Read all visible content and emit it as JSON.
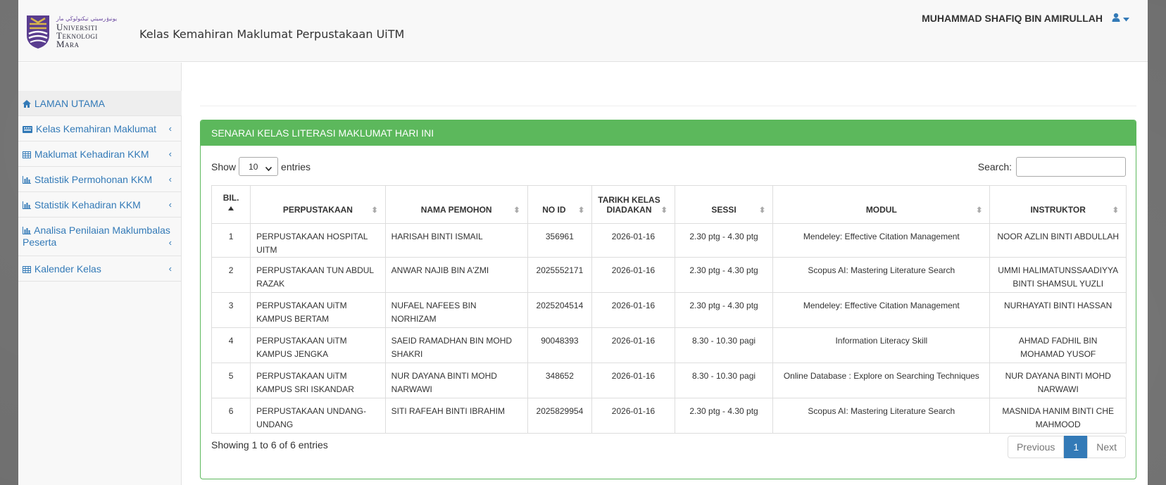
{
  "header": {
    "logo_jawi": "ﻳﻮﻧﻴۏرسيتي تيکنولوڬي مار",
    "logo_lines": [
      "Universiti",
      "Teknologi",
      "Mara"
    ],
    "app_title": "Kelas Kemahiran Maklumat Perpustakaan UiTM",
    "user_name": "MUHAMMAD SHAFIQ BIN AMIRULLAH"
  },
  "sidebar": {
    "items": [
      {
        "label": "LAMAN UTAMA",
        "icon": "home-icon"
      },
      {
        "label": "Kelas Kemahiran Maklumat",
        "icon": "keyboard-icon"
      },
      {
        "label": "Maklumat Kehadiran KKM",
        "icon": "table-icon"
      },
      {
        "label": "Statistik Permohonan KKM",
        "icon": "bar-chart-icon"
      },
      {
        "label": "Statistik Kehadiran KKM",
        "icon": "bar-chart-icon"
      },
      {
        "label": "Analisa Penilaian Maklumbalas",
        "label2": "Peserta",
        "icon": "bar-chart-icon"
      },
      {
        "label": "Kalender Kelas",
        "icon": "table-icon"
      }
    ]
  },
  "panel": {
    "heading": "SENARAI KELAS LITERASI MAKLUMAT HARI INI",
    "show_label": "Show",
    "entries_label": "entries",
    "page_length": "10",
    "search_label": "Search:",
    "search_value": "",
    "info": "Showing 1 to 6 of 6 entries",
    "pager": {
      "previous": "Previous",
      "current": "1",
      "next": "Next"
    }
  },
  "table": {
    "headers": [
      {
        "l1": "BIL.",
        "l2": ""
      },
      {
        "l1": "PERPUSTAKAAN",
        "l2": ""
      },
      {
        "l1": "NAMA PEMOHON",
        "l2": ""
      },
      {
        "l1": "NO ID",
        "l2": ""
      },
      {
        "l1": "TARIKH KELAS",
        "l2": "DIADAKAN"
      },
      {
        "l1": "SESSI",
        "l2": ""
      },
      {
        "l1": "MODUL",
        "l2": ""
      },
      {
        "l1": "INSTRUKTOR",
        "l2": ""
      }
    ],
    "rows": [
      [
        "1",
        "PERPUSTAKAAN HOSPITAL UITM",
        "HARISAH BINTI ISMAIL",
        "356961",
        "2026-01-16",
        "2.30 ptg - 4.30 ptg",
        "Mendeley: Effective Citation Management",
        "NOOR AZLIN BINTI ABDULLAH"
      ],
      [
        "2",
        "PERPUSTAKAAN TUN ABDUL RAZAK",
        "ANWAR NAJIB BIN A'ZMI",
        "2025552171",
        "2026-01-16",
        "2.30 ptg - 4.30 ptg",
        "Scopus AI: Mastering Literature Search",
        "UMMI HALIMATUNSSAADIYYA BINTI SHAMSUL YUZLI"
      ],
      [
        "3",
        "PERPUSTAKAAN UiTM KAMPUS BERTAM",
        "NUFAEL NAFEES BIN NORHIZAM",
        "2025204514",
        "2026-01-16",
        "2.30 ptg - 4.30 ptg",
        "Mendeley: Effective Citation Management",
        "NURHAYATI BINTI HASSAN"
      ],
      [
        "4",
        "PERPUSTAKAAN UiTM KAMPUS JENGKA",
        "SAEID RAMADHAN BIN MOHD SHAKRI",
        "90048393",
        "2026-01-16",
        "8.30 - 10.30 pagi",
        "Information Literacy Skill",
        "AHMAD FADHIL BIN MOHAMAD YUSOF"
      ],
      [
        "5",
        "PERPUSTAKAAN UiTM KAMPUS SRI ISKANDAR",
        "NUR DAYANA BINTI MOHD NARWAWI",
        "348652",
        "2026-01-16",
        "8.30 - 10.30 pagi",
        "Online Database : Explore on Searching Techniques",
        "NUR DAYANA BINTI MOHD NARWAWI"
      ],
      [
        "6",
        "PERPUSTAKAAN UNDANG-UNDANG",
        "SITI RAFEAH BINTI IBRAHIM",
        "2025829954",
        "2026-01-16",
        "2.30 ptg - 4.30 ptg",
        "Scopus AI: Mastering Literature Search",
        "MASNIDA HANIM BINTI CHE MAHMOOD"
      ]
    ]
  },
  "colors": {
    "panel_green": "#5cb85c",
    "link_blue": "#337ab7",
    "pager_active": "#337ab7"
  }
}
